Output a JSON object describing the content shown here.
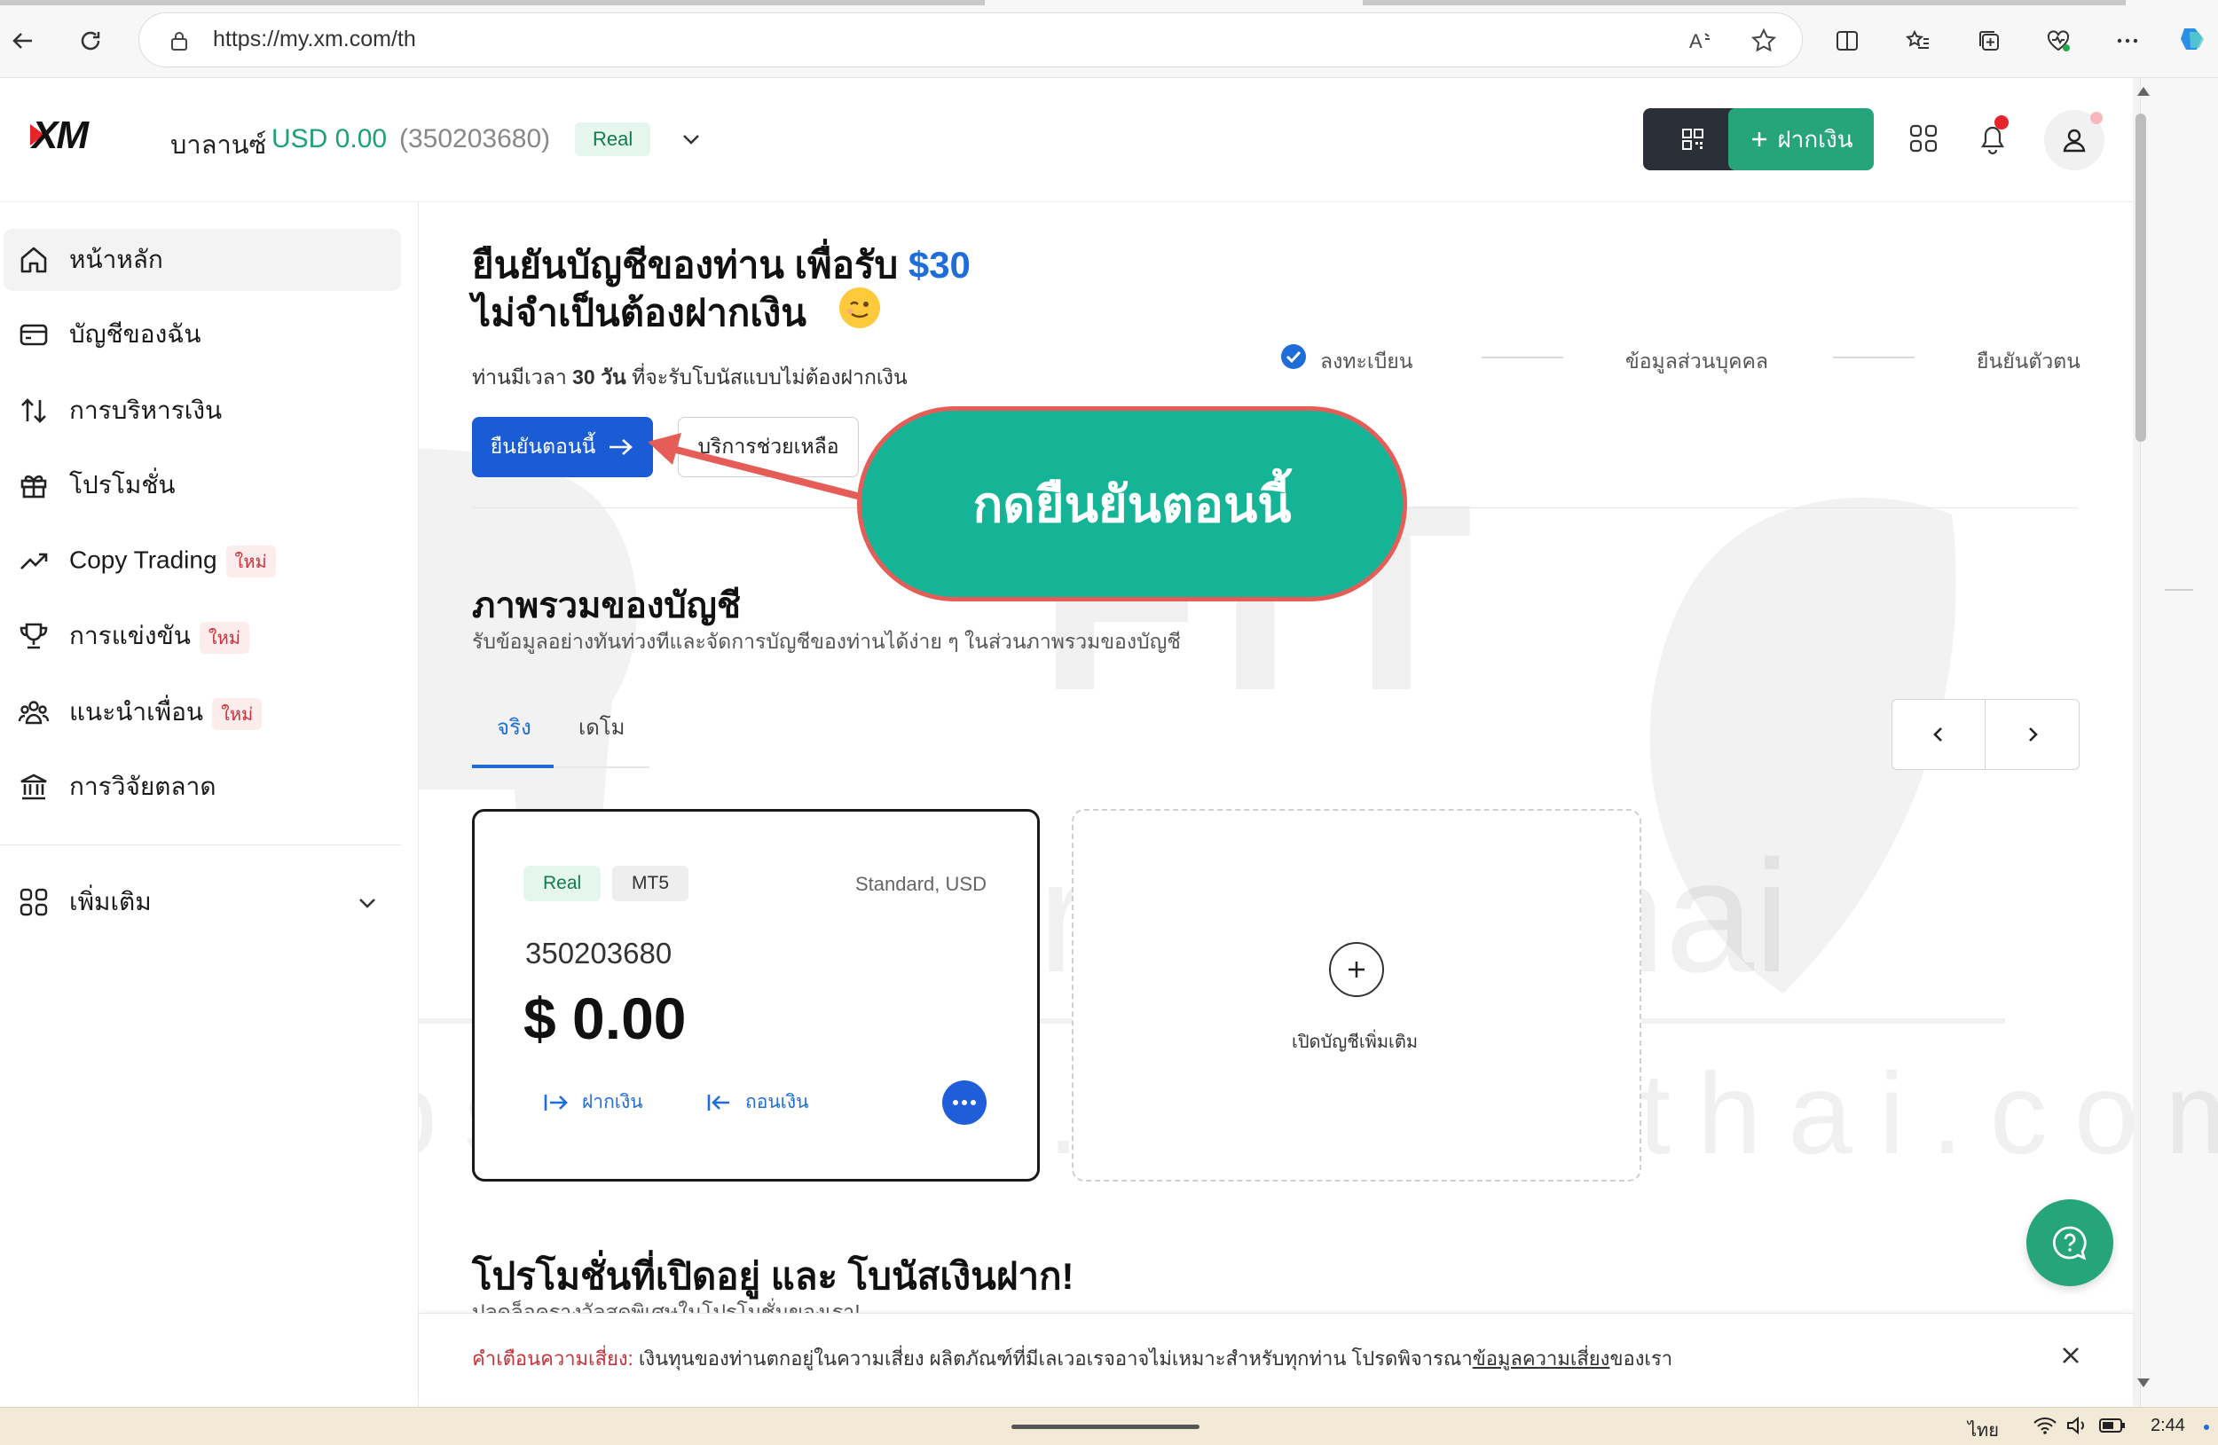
{
  "browser": {
    "url": "https://my.xm.com/th"
  },
  "header": {
    "logo": "XM",
    "balance_label": "บาลานซ์",
    "balance_value": "USD 0.00",
    "balance_account": "(350203680)",
    "balance_badge": "Real",
    "deposit_label": "ฝากเงิน"
  },
  "sidebar": {
    "items": [
      {
        "label": "หน้าหลัก",
        "icon": "home-icon"
      },
      {
        "label": "บัญชีของฉัน",
        "icon": "wallet-icon"
      },
      {
        "label": "การบริหารเงิน",
        "icon": "transfer-icon"
      },
      {
        "label": "โปรโมชั่น",
        "icon": "gift-icon"
      },
      {
        "label": "Copy Trading",
        "icon": "trend-icon",
        "badge": "ใหม่"
      },
      {
        "label": "การแข่งขัน",
        "icon": "trophy-icon",
        "badge": "ใหม่"
      },
      {
        "label": "แนะนำเพื่อน",
        "icon": "people-icon",
        "badge": "ใหม่"
      },
      {
        "label": "การวิจัยตลาด",
        "icon": "bank-icon"
      }
    ],
    "more_label": "เพิ่มเติม"
  },
  "verify": {
    "title_line1": "ยืนยันบัญชีของท่าน เพื่อรับ ",
    "title_amount": "$30",
    "title_line2": "ไม่จำเป็นต้องฝากเงิน",
    "subtitle_prefix": "ท่านมีเวลา ",
    "subtitle_days": "30 วัน",
    "subtitle_suffix": " ที่จะรับโบนัสแบบไม่ต้องฝากเงิน",
    "verify_now": "ยืนยันตอนนี้",
    "help": "บริการช่วยเหลือ",
    "steps": [
      "ลงทะเบียน",
      "ข้อมูลส่วนบุคคล",
      "ยืนยันตัวตน"
    ]
  },
  "annotation": {
    "callout": "กดยืนยันตอนนี้"
  },
  "overview": {
    "title": "ภาพรวมของบัญชี",
    "subtitle": "รับข้อมูลอย่างทันท่วงทีและจัดการบัญชีของท่านได้ง่าย ๆ ในส่วนภาพรวมของบัญชี",
    "tabs": [
      "จริง",
      "เดโม"
    ]
  },
  "account_card": {
    "badge_type": "Real",
    "badge_platform": "MT5",
    "account_kind": "Standard, USD",
    "account_number": "350203680",
    "balance": "$ 0.00",
    "deposit": "ฝากเงิน",
    "withdraw": "ถอนเงิน"
  },
  "add_account": {
    "label": "เปิดบัญชีเพิ่มเติม"
  },
  "promo": {
    "title": "โปรโมชั่นที่เปิดอยู่ และ โบนัสเงินฝาก!",
    "subtitle": "ปลดล็อครางวัลสุดพิเศษในโปรโมชั่นของเรา!"
  },
  "risk": {
    "label": "คำเตือนความเสี่ยง:",
    "text": " เงินทุนของท่านตกอยู่ในความเสี่ยง ผลิตภัณฑ์ที่มีเลเวอเรจอาจไม่เหมาะสำหรับทุกท่าน โปรดพิจารณา",
    "link": "ข้อมูลความเสี่ยง",
    "suffix": "ของเรา"
  },
  "watermark": {
    "big": "FIT",
    "mid": "Forex In Thai",
    "url": "https://www.forexinthai.com"
  },
  "taskbar": {
    "language": "ไทย",
    "time": "2:44"
  },
  "colors": {
    "brand_green": "#27a57a",
    "brand_blue": "#1a5bd6",
    "callout_fill": "#16b496",
    "callout_border": "#e65d57"
  }
}
